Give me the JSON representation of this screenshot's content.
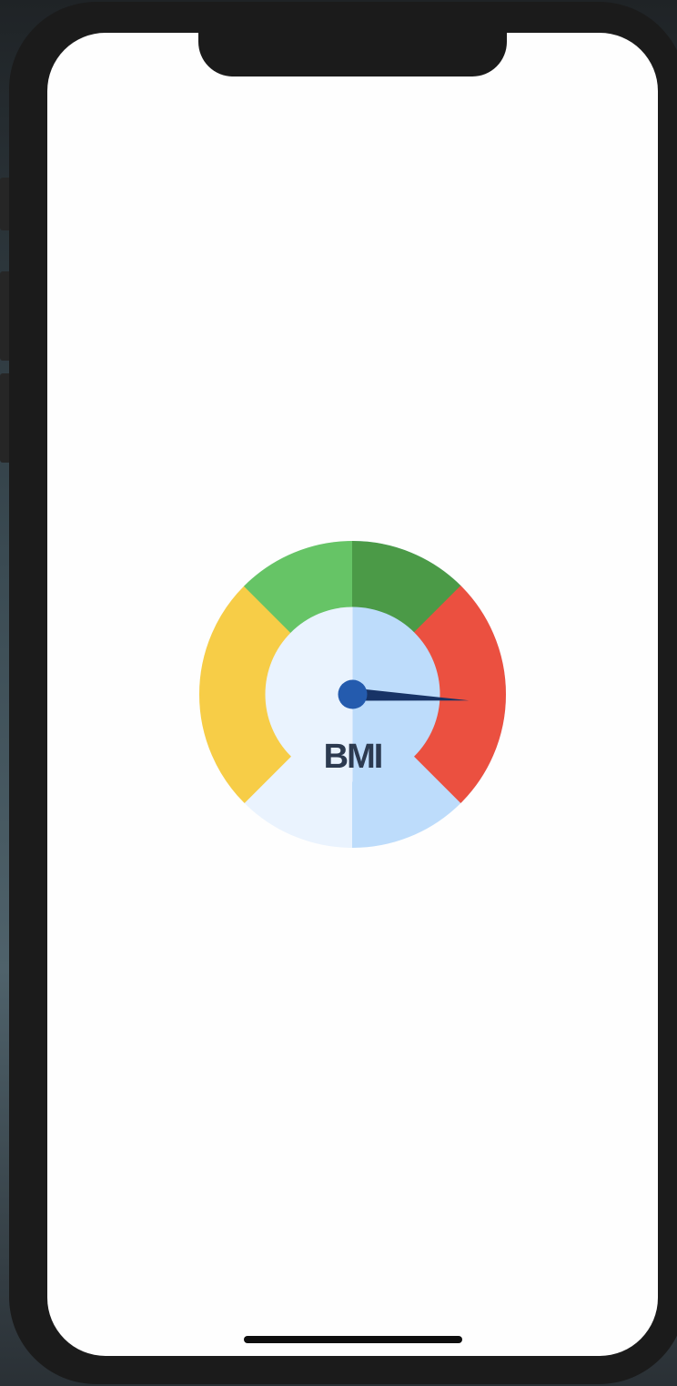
{
  "gauge": {
    "label": "BMI",
    "needle_angle_deg": 3,
    "colors": {
      "underweight": "#f7cd47",
      "normal_left": "#66c466",
      "normal_right": "#4b9a47",
      "obese": "#eb5040",
      "face_left": "#eaf3fe",
      "face_right": "#bddcfb",
      "needle": "#173366",
      "hub": "#245bae",
      "label": "#2c3a50"
    }
  }
}
